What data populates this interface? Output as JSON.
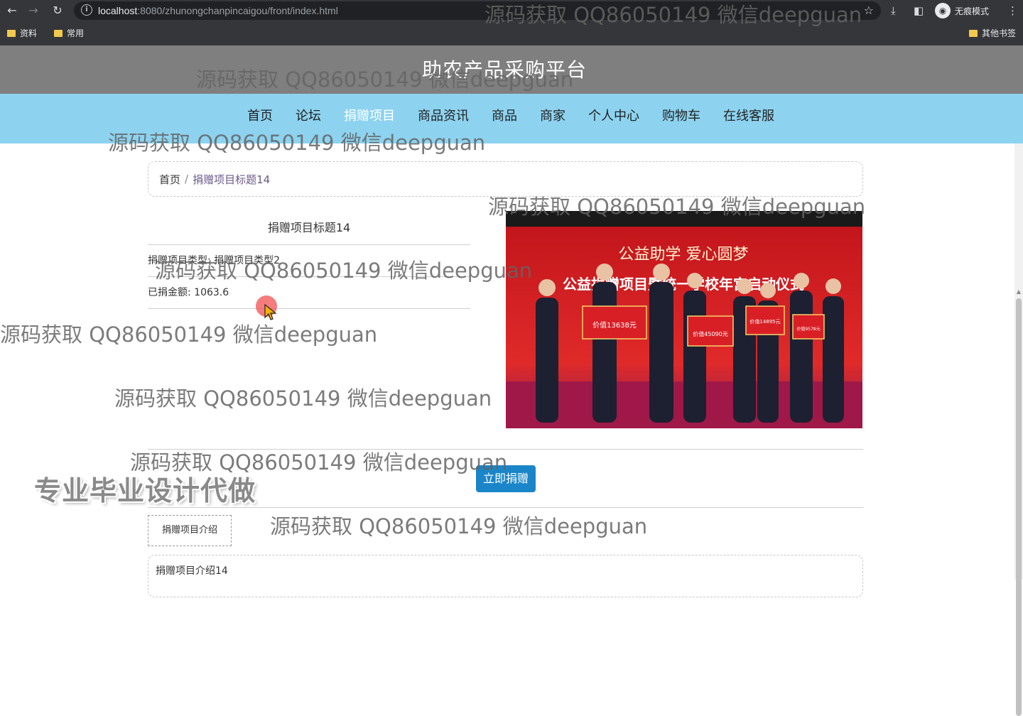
{
  "browser": {
    "url_host": "localhost",
    "url_rest": ":8080/zhunongchanpincaigou/front/index.html",
    "incognito_label": "无痕模式",
    "bookmarks": [
      {
        "label": "资料"
      },
      {
        "label": "常用"
      }
    ],
    "other_bookmarks": "其他书签"
  },
  "site": {
    "title": "助农产品采购平台",
    "nav": [
      {
        "label": "首页",
        "active": false
      },
      {
        "label": "论坛",
        "active": false
      },
      {
        "label": "捐赠项目",
        "active": true
      },
      {
        "label": "商品资讯",
        "active": false
      },
      {
        "label": "商品",
        "active": false
      },
      {
        "label": "商家",
        "active": false
      },
      {
        "label": "个人中心",
        "active": false
      },
      {
        "label": "购物车",
        "active": false
      },
      {
        "label": "在线客服",
        "active": false
      }
    ]
  },
  "breadcrumb": {
    "home": "首页",
    "separator": "/",
    "current": "捐赠项目标题14"
  },
  "detail": {
    "title": "捐赠项目标题14",
    "type_label": "捐赠项目类型:",
    "type_value": "捐赠项目类型2",
    "amount_label": "已捐金额:",
    "amount_value": "1063.6"
  },
  "photo": {
    "banner_text": "公益助学 爱心圆梦",
    "headline_text": "公益捐赠项目暨统一学校年宫启动仪式",
    "sign_texts": [
      "价值13638元",
      "价值45090元",
      "价值14895元",
      "价值9578元"
    ]
  },
  "actions": {
    "donate_label": "立即捐赠",
    "intro_tab_label": "捐赠项目介绍"
  },
  "intro": {
    "text": "捐赠项目介绍14"
  },
  "watermarks": {
    "text": "源码获取 QQ86050149 微信deepguan",
    "big_text": "专业毕业设计代做"
  }
}
